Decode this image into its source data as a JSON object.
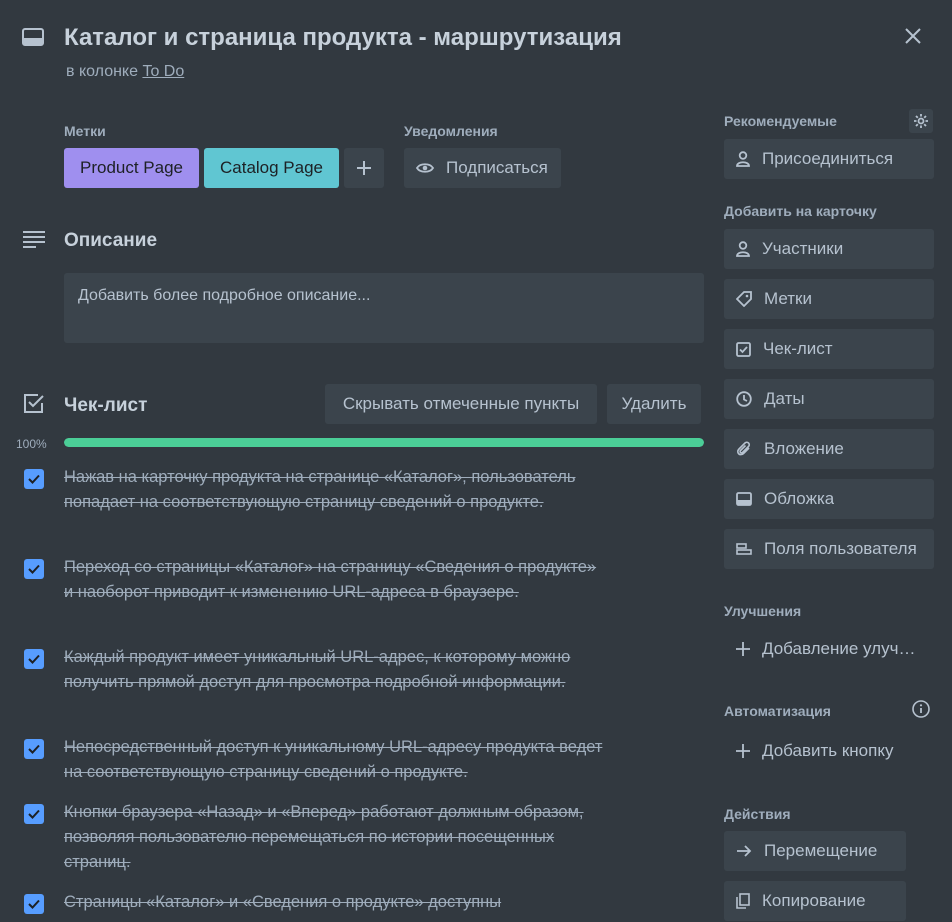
{
  "card": {
    "title": "Каталог и страница продукта - маршрутизация",
    "in_column_prefix": "в колонке",
    "column_name": "To Do"
  },
  "labels_section": {
    "heading": "Метки",
    "labels": [
      {
        "text": "Product Page",
        "color": "#9f8fef"
      },
      {
        "text": "Catalog Page",
        "color": "#60c6d2"
      }
    ]
  },
  "notifications": {
    "heading": "Уведомления",
    "subscribe_label": "Подписаться"
  },
  "description": {
    "heading": "Описание",
    "placeholder": "Добавить более подробное описание..."
  },
  "checklist": {
    "heading": "Чек-лист",
    "hide_checked_label": "Скрывать отмеченные пункты",
    "delete_label": "Удалить",
    "progress_text": "100%",
    "progress_fraction": 1.0,
    "items": [
      {
        "text": "Нажав на карточку продукта на странице «Каталог», пользователь попадает на соответствующую страницу сведений о продукте.",
        "checked": true
      },
      {
        "text": "Переход со страницы «Каталог» на страницу «Сведения о продукте» и наоборот приводит к изменению URL-адреса в браузере.",
        "checked": true
      },
      {
        "text": "Каждый продукт имеет уникальный URL-адрес, к которому можно получить прямой доступ для просмотра подробной информации.",
        "checked": true
      },
      {
        "text": "Непосредственный доступ к уникальному URL-адресу продукта ведет на соответствующую страницу сведений о продукте.",
        "checked": true
      },
      {
        "text": "Кнопки браузера «Назад» и «Вперед» работают должным образом, позволяя пользователю перемещаться по истории посещенных страниц.",
        "checked": true
      },
      {
        "text": "Страницы «Каталог» и «Сведения о продукте» доступны",
        "checked": true
      }
    ]
  },
  "sidebar": {
    "suggested_heading": "Рекомендуемые",
    "join_label": "Присоединиться",
    "add_to_card_heading": "Добавить на карточку",
    "add_to_card": [
      {
        "label": "Участники",
        "icon": "person-icon"
      },
      {
        "label": "Метки",
        "icon": "tag-icon"
      },
      {
        "label": "Чек-лист",
        "icon": "checkbox-icon"
      },
      {
        "label": "Даты",
        "icon": "clock-icon"
      },
      {
        "label": "Вложение",
        "icon": "paperclip-icon"
      },
      {
        "label": "Обложка",
        "icon": "cover-icon"
      },
      {
        "label": "Поля пользователя",
        "icon": "custom-fields-icon"
      }
    ],
    "powerups_heading": "Улучшения",
    "add_powerup_label": "Добавление улучшений",
    "automation_heading": "Автоматизация",
    "add_button_label": "Добавить кнопку",
    "actions_heading": "Действия",
    "actions": [
      {
        "label": "Перемещение",
        "icon": "arrow-right-icon"
      },
      {
        "label": "Копирование",
        "icon": "copy-icon"
      }
    ]
  }
}
